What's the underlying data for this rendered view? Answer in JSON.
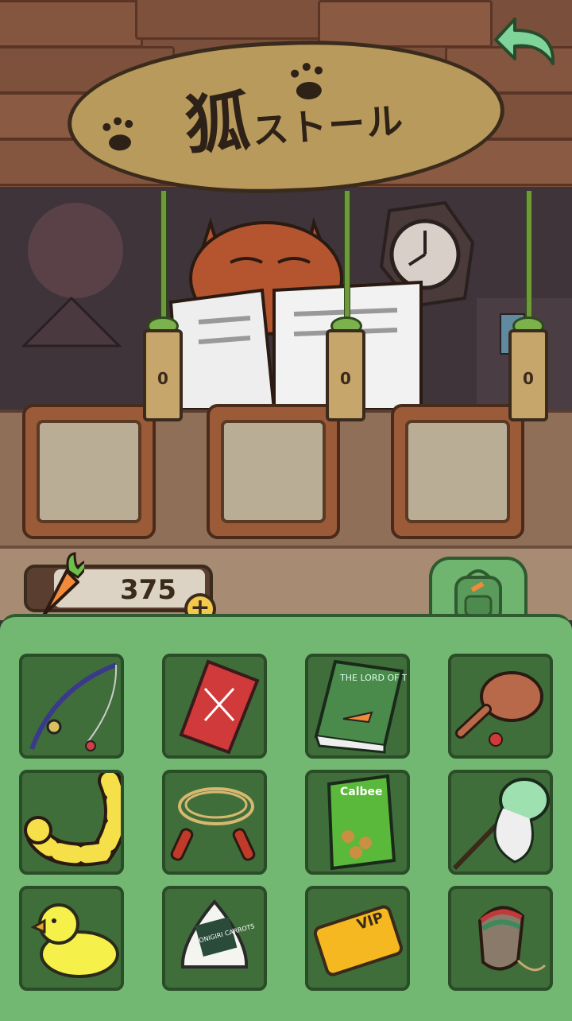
{
  "sign": {
    "title_kanji": "狐",
    "title_kana": "ストール"
  },
  "back_button": {
    "icon": "back-arrow-icon"
  },
  "price_tags": [
    {
      "value": "0"
    },
    {
      "value": "0"
    },
    {
      "value": "0"
    }
  ],
  "currency": {
    "icon": "carrot-icon",
    "amount": "375",
    "plus_label": "+"
  },
  "bag_tab": {
    "icon": "backpack-icon"
  },
  "items": [
    {
      "name": "fishing-rod"
    },
    {
      "name": "hanafuda-cards"
    },
    {
      "name": "lord-of-the-carrots-book"
    },
    {
      "name": "battledore-paddle"
    },
    {
      "name": "swim-ring"
    },
    {
      "name": "jump-rope"
    },
    {
      "name": "carrot-snack-bag"
    },
    {
      "name": "bug-net"
    },
    {
      "name": "rubber-duck"
    },
    {
      "name": "onigiri"
    },
    {
      "name": "vip-card"
    },
    {
      "name": "spinning-top"
    }
  ],
  "item_texts": {
    "book_title": "THE LORD OF THE CARROTS",
    "snack_brand": "Calbee",
    "onigiri_label": "ONIGIRI CARROTS",
    "vip_label": "VIP"
  },
  "colors": {
    "panel": "#72b872",
    "slot": "#3f6e3b",
    "roof": "#7a4f3b",
    "sign": "#b89a5c"
  }
}
